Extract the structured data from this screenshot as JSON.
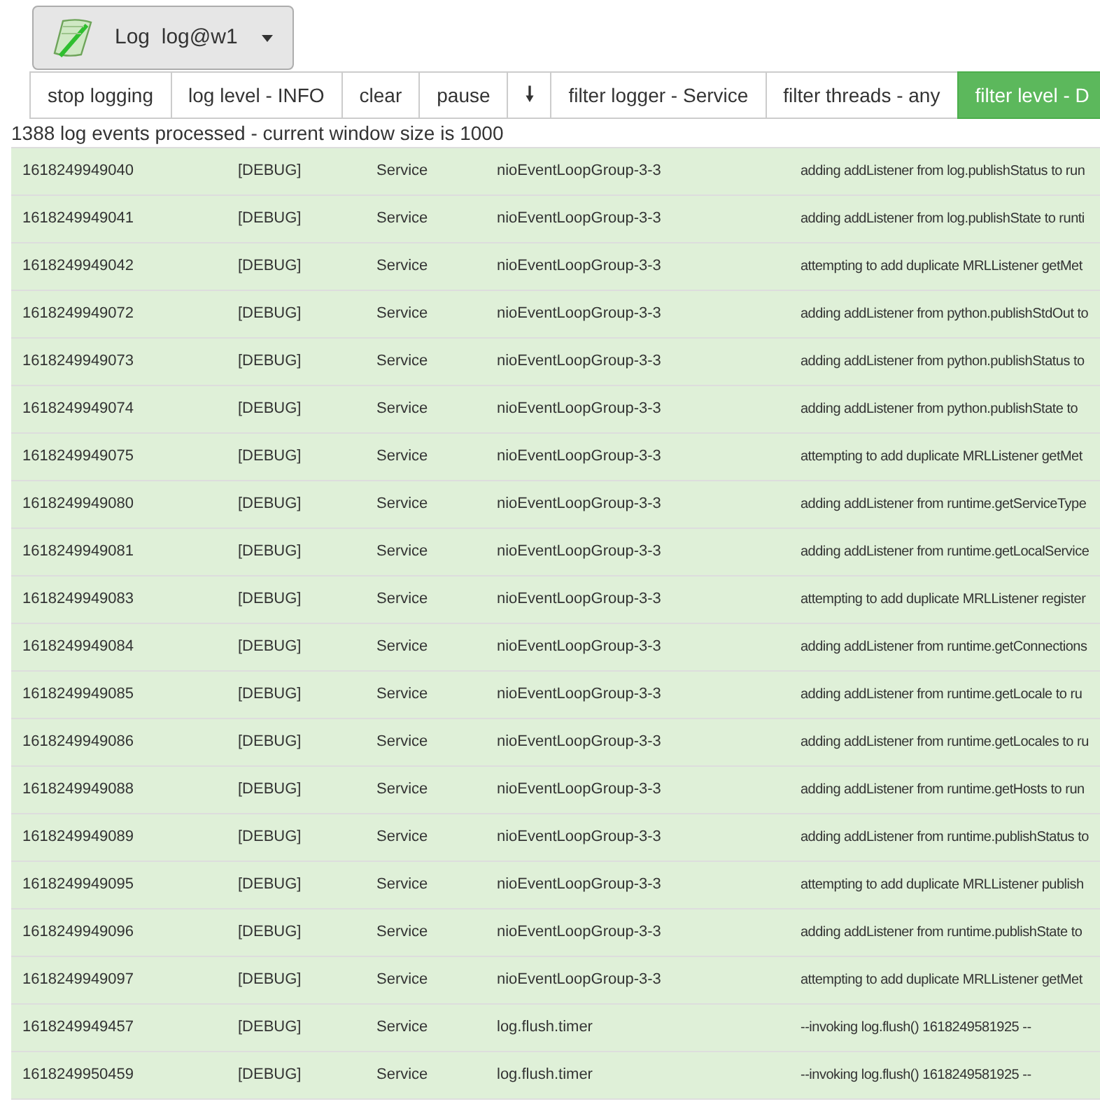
{
  "service_button": {
    "label": "Log  log@w1"
  },
  "toolbar": [
    {
      "label": "stop logging",
      "active": false
    },
    {
      "label": "log level - INFO",
      "active": false
    },
    {
      "label": "clear",
      "active": false
    },
    {
      "label": "pause",
      "active": false
    },
    {
      "label": "🠗",
      "kind": "icon",
      "active": false
    },
    {
      "label": "filter logger - Service",
      "active": false
    },
    {
      "label": "filter threads - any",
      "active": false
    },
    {
      "label": "filter level - D",
      "active": true
    }
  ],
  "status": "1388 log events processed - current window size is 1000",
  "rows": [
    {
      "ts": "1618249949040",
      "level": "[DEBUG]",
      "logger": "Service",
      "thread": "nioEventLoopGroup-3-3",
      "message": "adding addListener from log.publishStatus to run"
    },
    {
      "ts": "1618249949041",
      "level": "[DEBUG]",
      "logger": "Service",
      "thread": "nioEventLoopGroup-3-3",
      "message": "adding addListener from log.publishState to runti"
    },
    {
      "ts": "1618249949042",
      "level": "[DEBUG]",
      "logger": "Service",
      "thread": "nioEventLoopGroup-3-3",
      "message": "attempting to add duplicate MRLListener getMet"
    },
    {
      "ts": "1618249949072",
      "level": "[DEBUG]",
      "logger": "Service",
      "thread": "nioEventLoopGroup-3-3",
      "message": "adding addListener from python.publishStdOut to"
    },
    {
      "ts": "1618249949073",
      "level": "[DEBUG]",
      "logger": "Service",
      "thread": "nioEventLoopGroup-3-3",
      "message": "adding addListener from python.publishStatus to"
    },
    {
      "ts": "1618249949074",
      "level": "[DEBUG]",
      "logger": "Service",
      "thread": "nioEventLoopGroup-3-3",
      "message": "adding addListener from python.publishState to"
    },
    {
      "ts": "1618249949075",
      "level": "[DEBUG]",
      "logger": "Service",
      "thread": "nioEventLoopGroup-3-3",
      "message": "attempting to add duplicate MRLListener getMet"
    },
    {
      "ts": "1618249949080",
      "level": "[DEBUG]",
      "logger": "Service",
      "thread": "nioEventLoopGroup-3-3",
      "message": "adding addListener from runtime.getServiceType"
    },
    {
      "ts": "1618249949081",
      "level": "[DEBUG]",
      "logger": "Service",
      "thread": "nioEventLoopGroup-3-3",
      "message": "adding addListener from runtime.getLocalService"
    },
    {
      "ts": "1618249949083",
      "level": "[DEBUG]",
      "logger": "Service",
      "thread": "nioEventLoopGroup-3-3",
      "message": "attempting to add duplicate MRLListener register"
    },
    {
      "ts": "1618249949084",
      "level": "[DEBUG]",
      "logger": "Service",
      "thread": "nioEventLoopGroup-3-3",
      "message": "adding addListener from runtime.getConnections"
    },
    {
      "ts": "1618249949085",
      "level": "[DEBUG]",
      "logger": "Service",
      "thread": "nioEventLoopGroup-3-3",
      "message": "adding addListener from runtime.getLocale to ru"
    },
    {
      "ts": "1618249949086",
      "level": "[DEBUG]",
      "logger": "Service",
      "thread": "nioEventLoopGroup-3-3",
      "message": "adding addListener from runtime.getLocales to ru"
    },
    {
      "ts": "1618249949088",
      "level": "[DEBUG]",
      "logger": "Service",
      "thread": "nioEventLoopGroup-3-3",
      "message": "adding addListener from runtime.getHosts to run"
    },
    {
      "ts": "1618249949089",
      "level": "[DEBUG]",
      "logger": "Service",
      "thread": "nioEventLoopGroup-3-3",
      "message": "adding addListener from runtime.publishStatus to"
    },
    {
      "ts": "1618249949095",
      "level": "[DEBUG]",
      "logger": "Service",
      "thread": "nioEventLoopGroup-3-3",
      "message": "attempting to add duplicate MRLListener publish"
    },
    {
      "ts": "1618249949096",
      "level": "[DEBUG]",
      "logger": "Service",
      "thread": "nioEventLoopGroup-3-3",
      "message": "adding addListener from runtime.publishState to"
    },
    {
      "ts": "1618249949097",
      "level": "[DEBUG]",
      "logger": "Service",
      "thread": "nioEventLoopGroup-3-3",
      "message": "attempting to add duplicate MRLListener getMet"
    },
    {
      "ts": "1618249949457",
      "level": "[DEBUG]",
      "logger": "Service",
      "thread": "log.flush.timer",
      "message": "--invoking log.flush() 1618249581925 --"
    },
    {
      "ts": "1618249950459",
      "level": "[DEBUG]",
      "logger": "Service",
      "thread": "log.flush.timer",
      "message": "--invoking log.flush() 1618249581925 --"
    }
  ]
}
